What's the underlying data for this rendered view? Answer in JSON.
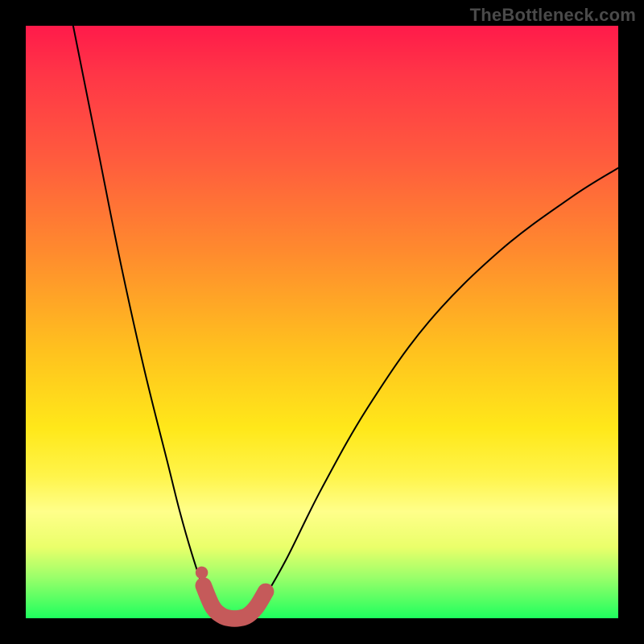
{
  "watermark": "TheBottleneck.com",
  "colors": {
    "curve": "#000000",
    "marker_fill": "#c55a5a",
    "marker_stroke": "#c55a5a",
    "gradient_top": "#ff1a4a",
    "gradient_bottom": "#1eff5e",
    "frame": "#000000"
  },
  "chart_data": {
    "type": "line",
    "title": "",
    "xlabel": "",
    "ylabel": "",
    "xlim": [
      0,
      100
    ],
    "ylim": [
      0,
      100
    ],
    "series": [
      {
        "name": "left-branch",
        "x": [
          8,
          12,
          16,
          20,
          24,
          26,
          28,
          30,
          31.5,
          33
        ],
        "y": [
          100,
          80,
          60,
          42,
          26,
          18,
          11,
          5,
          2,
          0
        ]
      },
      {
        "name": "right-branch",
        "x": [
          38,
          40,
          44,
          50,
          58,
          68,
          80,
          92,
          100
        ],
        "y": [
          0,
          3,
          10,
          22,
          36,
          50,
          62,
          71,
          76
        ]
      }
    ],
    "markers": {
      "name": "bottom-highlight",
      "points": [
        {
          "x": 30.0,
          "y": 5.5
        },
        {
          "x": 31.5,
          "y": 2.0
        },
        {
          "x": 33.0,
          "y": 0.5
        },
        {
          "x": 34.5,
          "y": 0.0
        },
        {
          "x": 36.0,
          "y": 0.0
        },
        {
          "x": 37.5,
          "y": 0.5
        },
        {
          "x": 39.0,
          "y": 2.0
        },
        {
          "x": 40.5,
          "y": 4.5
        }
      ],
      "radius_data_units": 1.4
    }
  }
}
